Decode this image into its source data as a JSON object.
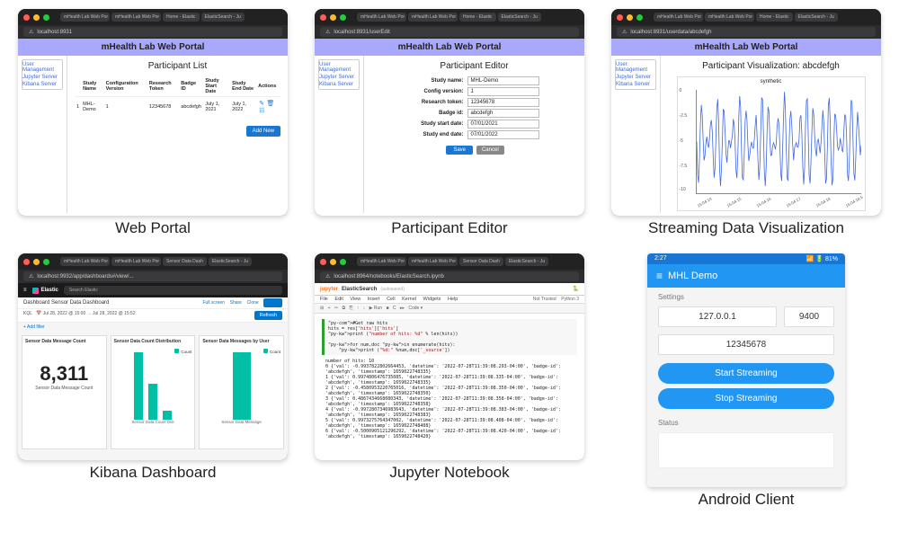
{
  "captions": {
    "web_portal": "Web Portal",
    "participant_editor": "Participant Editor",
    "streaming_viz": "Streaming Data Visualization",
    "kibana": "Kibana Dashboard",
    "jupyter": "Jupyter Notebook",
    "android": "Android Client"
  },
  "browser_tabs": [
    "mHealth Lab Web Por",
    "mHealth Lab Web Por",
    "Home - Elastic",
    "ElasticSearch - Ju"
  ],
  "portal": {
    "header": "mHealth Lab Web Portal",
    "addr_list": "localhost:8931",
    "addr_edit": "localhost:8931/userEdit",
    "addr_viz": "localhost:8931/userdata/abcdefgh",
    "nav": {
      "user_management": "User Management",
      "jupyter_server": "Jupyter Server",
      "kibana_server": "Kibana Server"
    },
    "list": {
      "title": "Participant List",
      "columns": [
        "",
        "Study Name",
        "Configuration Version",
        "Research Token",
        "Badge ID",
        "Study Start Date",
        "Study End Date",
        "Actions"
      ],
      "row": {
        "idx": "1",
        "study_name": "MHL-Demo",
        "config_version": "1",
        "research_token": "12345678",
        "badge_id": "abcdefgh",
        "start": "July 1, 2021",
        "end": "July 1, 2022"
      },
      "add_new": "Add New"
    },
    "editor": {
      "title": "Participant Editor",
      "fields": {
        "study_name": {
          "label": "Study name:",
          "value": "MHL-Demo"
        },
        "config_version": {
          "label": "Config version:",
          "value": "1"
        },
        "research_token": {
          "label": "Research token:",
          "value": "12345678"
        },
        "badge_id": {
          "label": "Badge id:",
          "value": "abcdefgh"
        },
        "start": {
          "label": "Study start date:",
          "value": "07/01/2021"
        },
        "end": {
          "label": "Study end date:",
          "value": "07/01/2022"
        }
      },
      "save": "Save",
      "cancel": "Cancel"
    },
    "viz": {
      "title": "Participant Visualization: abcdefgh",
      "chart_title": "synthetic"
    }
  },
  "chart_data": {
    "type": "line",
    "title": "synthetic",
    "ylim": [
      -10,
      0
    ],
    "yticks": [
      -10,
      -7.5,
      -5,
      -2.5,
      0
    ],
    "xticks": [
      "15:04:14",
      "15:04:15",
      "15:04:16",
      "15:04:17",
      "15:04:18",
      "15:04:18.5"
    ]
  },
  "kibana": {
    "addr": "localhost:9932/app/dashboards#/view/...",
    "brand": "Elastic",
    "search_placeholder": "Search Elastic",
    "breadcrumb": "Dashboard     Sensor Data Dashboard",
    "actions": {
      "fullscreen": "Full screen",
      "share": "Share",
      "clone": "Clone",
      "edit": "Edit"
    },
    "query": {
      "kql": "KQL",
      "range": "Jul 28, 2022 @ 15:00  →  Jul 28, 2022 @ 15:52",
      "refresh": "Refresh"
    },
    "add_filter": "+ Add filter",
    "panels": {
      "count": {
        "title": "Sensor Data Message Count",
        "value": "8,311",
        "label": "Sensor Data Message Count"
      },
      "dist": {
        "title": "Sensor Data Count Distribution",
        "legend": "Count",
        "xlabel": "Sensor Data Count Dist"
      },
      "user": {
        "title": "Sensor Data Messages by User",
        "legend": "Count",
        "xlabel": "Sensor Data Message"
      }
    }
  },
  "jupyter": {
    "addr": "localhost:8964/notebooks/ElasticSearch.ipynb",
    "brand": "jupyter",
    "title": "ElasticSearch",
    "autosaved": "(autosaved)",
    "menu": [
      "File",
      "Edit",
      "View",
      "Insert",
      "Cell",
      "Kernel",
      "Widgets",
      "Help"
    ],
    "trusted": "Not Trusted",
    "kernel": "Python 3",
    "toolbar": [
      "⊞",
      "+",
      "✂",
      "⧉",
      "⎘",
      "↑",
      "↓",
      "▶ Run",
      "■",
      "C",
      "▸▸",
      "Code ▾"
    ],
    "code": "#Get raw hits\nhits = res['hits']['hits']\nprint (\"number of hits: %d\" % len(hits))\n\nfor num,doc in enumerate(hits):\n    print (\"%d:\" %num,doc['_source'])",
    "output_header": "number of hits: 10",
    "output_lines": [
      "0 {'val': -0.9937822802664453, 'datetime': '2022-07-28T11:39:08.293-04:00', 'badge-id': 'abcdefgh', 'timestamp': 1659022748335}",
      "1 {'val': 0.9974806476735085, 'datetime': '2022-07-28T11:39:08.335-04:00', 'badge-id': 'abcdefgh', 'timestamp': 1659022748335}",
      "2 {'val': -0.4580953220765016, 'datetime': '2022-07-28T11:39:08.350-04:00', 'badge-id': 'abcdefgh', 'timestamp': 1659022748350}",
      "3 {'val': 0.4867434668080343, 'datetime': '2022-07-28T11:39:08.358-04:00', 'badge-id': 'abcdefgh', 'timestamp': 1659022748358}",
      "4 {'val': -0.9972807346983643, 'datetime': '2022-07-28T11:39:08.383-04:00', 'badge-id': 'abcdefgh', 'timestamp': 1659022748383}",
      "5 {'val': 0.9973275764347002, 'datetime': '2022-07-28T11:39:08.408-04:00', 'badge-id': 'abcdefgh', 'timestamp': 1659022748408}",
      "6 {'val': -0.5000905121296292, 'datetime': '2022-07-28T11:39:08.420-04:00', 'badge-id': 'abcdefgh', 'timestamp': 1659022748420}"
    ]
  },
  "android": {
    "time": "2:27",
    "status_icons": "📶 🔋 81%",
    "title": "MHL Demo",
    "settings_label": "Settings",
    "ip": "127.0.0.1",
    "port": "9400",
    "token": "12345678",
    "start": "Start Streaming",
    "stop": "Stop Streaming",
    "status_label": "Status"
  }
}
